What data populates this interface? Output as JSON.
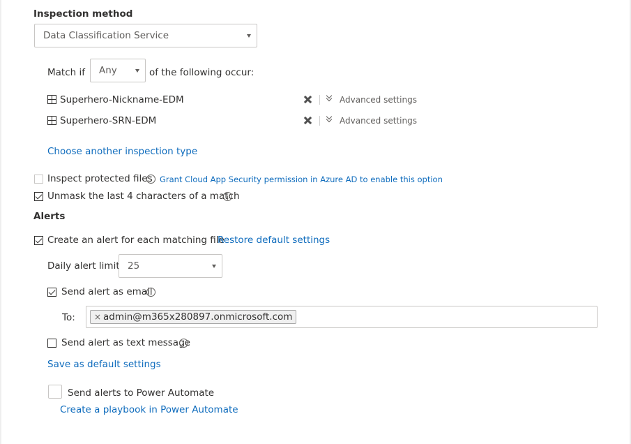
{
  "inspection": {
    "heading": "Inspection method",
    "method_value": "Data Classification Service",
    "match_prefix": "Match if",
    "match_value": "Any",
    "match_suffix": "of the following occur:",
    "items": [
      {
        "label": "Superhero-Nickname-EDM",
        "advanced": "Advanced settings"
      },
      {
        "label": "Superhero-SRN-EDM",
        "advanced": "Advanced settings"
      }
    ],
    "choose_another": "Choose another inspection type",
    "inspect_protected_label": "Inspect protected files",
    "inspect_protected_checked": false,
    "grant_link": "Grant Cloud App Security permission in Azure AD to enable this option",
    "unmask_label": "Unmask the last 4 characters of a match",
    "unmask_checked": true
  },
  "alerts": {
    "heading": "Alerts",
    "create_alert_label": "Create an alert for each matching file",
    "create_alert_checked": true,
    "restore_link": "Restore default settings",
    "daily_limit_label": "Daily alert limit",
    "daily_limit_value": "25",
    "send_email_label": "Send alert as email",
    "send_email_checked": true,
    "to_label": "To:",
    "to_recipients": [
      "admin@m365x280897.onmicrosoft.com"
    ],
    "send_text_label": "Send alert as text message",
    "send_text_checked": false,
    "save_default_link": "Save as default settings",
    "power_automate_label": "Send alerts to Power Automate",
    "power_automate_checked": false,
    "playbook_link": "Create a playbook in Power Automate"
  },
  "colors": {
    "link": "#0f6cbd",
    "text": "#323130",
    "border": "#c8c6c4"
  },
  "icons": [
    "grid-icon",
    "remove-x-icon",
    "double-chevron-down-icon",
    "info-icon",
    "chevron-down-icon",
    "checkbox-icon"
  ]
}
